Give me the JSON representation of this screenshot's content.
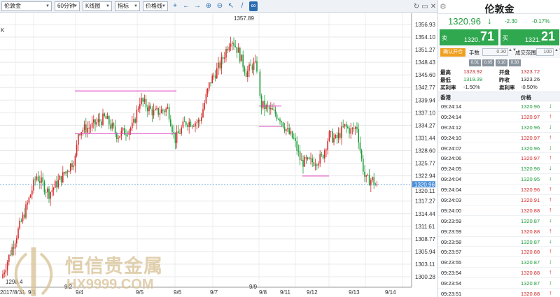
{
  "toolbar": {
    "symbol": "伦敦金",
    "period": "60分钟",
    "chart_type": "K线图",
    "indicator": "指标",
    "price_line": "价格线"
  },
  "chart": {
    "corner_label": "K",
    "price_labels": [
      "1356.93",
      "1354.10",
      "1351.27",
      "1348.43",
      "1345.60",
      "1342.77",
      "1339.94",
      "1337.10",
      "1334.27",
      "1331.44",
      "1328.60",
      "1325.77",
      "1322.94",
      "1317.27",
      "1314.44",
      "1311.61",
      "1308.77",
      "1305.94",
      "1303.11",
      "1300.28"
    ],
    "current_price_tag": "1320.96",
    "current_price_tag2": "1320.11",
    "high_marker": "1357.89",
    "low_marker": "1298.4",
    "date_labels": [
      "2017/8/31",
      "9/1",
      "9/4",
      "9/5",
      "9/6",
      "9/7",
      "9/8",
      "9/11",
      "9/12",
      "9/13",
      "9/14"
    ],
    "date_label_lower": "9/2",
    "date_label_9_9": "9/9",
    "colors": {
      "up": "#d62a2a",
      "down": "#1f9d3a",
      "boxline": "#e040c0",
      "pricedash": "#4a8fd8"
    }
  },
  "watermark": {
    "cn": "恒信贵金属",
    "url": "HX9999.COM"
  },
  "panel": {
    "title": "伦敦金",
    "last_price": "1320.96",
    "change": "-2.30",
    "change_pct": "-0.17%",
    "sell_label": "卖",
    "sell_small": "1320.",
    "sell_big": "71",
    "buy_label": "买",
    "buy_small": "1321.",
    "buy_big": "21",
    "confirm_label": "确认开仓",
    "qty_label": "手数",
    "qty_value": "0.30",
    "range_label": "成交范围",
    "range_value": "100",
    "chips": [
      "0.01",
      "0.05",
      "0.10",
      "0.30"
    ],
    "stats": {
      "high_label": "最高",
      "high": "1323.92",
      "open_label": "开盘",
      "open": "1323.72",
      "low_label": "最低",
      "low": "1319.39",
      "prev_label": "昨收",
      "prev": "1323.26",
      "buy_rate_label": "买利率",
      "buy_rate": "-1.50%",
      "sell_rate_label": "卖利率",
      "sell_rate": "-0.50%"
    },
    "ticks_header": {
      "market": "香港",
      "price": "价格"
    },
    "ticks": [
      {
        "time": "09:24:14",
        "price": "1320.96",
        "dir": "down"
      },
      {
        "time": "09:24:14",
        "price": "1320.97",
        "dir": "up"
      },
      {
        "time": "09:24:12",
        "price": "1320.96",
        "dir": "down"
      },
      {
        "time": "09:24:10",
        "price": "1320.97",
        "dir": "up"
      },
      {
        "time": "09:24:07",
        "price": "1320.96",
        "dir": "down"
      },
      {
        "time": "09:24:06",
        "price": "1320.97",
        "dir": "up"
      },
      {
        "time": "09:24:05",
        "price": "1320.96",
        "dir": "down"
      },
      {
        "time": "09:24:04",
        "price": "1320.95",
        "dir": "down"
      },
      {
        "time": "09:24:04",
        "price": "1320.96",
        "dir": "up"
      },
      {
        "time": "09:24:03",
        "price": "1320.91",
        "dir": "up"
      },
      {
        "time": "09:24:00",
        "price": "1320.88",
        "dir": "up"
      },
      {
        "time": "09:23:59",
        "price": "1320.87",
        "dir": "down"
      },
      {
        "time": "09:23:59",
        "price": "1320.88",
        "dir": "up"
      },
      {
        "time": "09:23:58",
        "price": "1320.87",
        "dir": "down"
      },
      {
        "time": "09:23:57",
        "price": "1320.88",
        "dir": "up"
      },
      {
        "time": "09:23:55",
        "price": "1320.87",
        "dir": "down"
      },
      {
        "time": "09:23:54",
        "price": "1320.88",
        "dir": "up"
      },
      {
        "time": "09:23:54",
        "price": "1320.87",
        "dir": "down"
      },
      {
        "time": "09:23:51",
        "price": "1320.88",
        "dir": "up"
      }
    ]
  }
}
